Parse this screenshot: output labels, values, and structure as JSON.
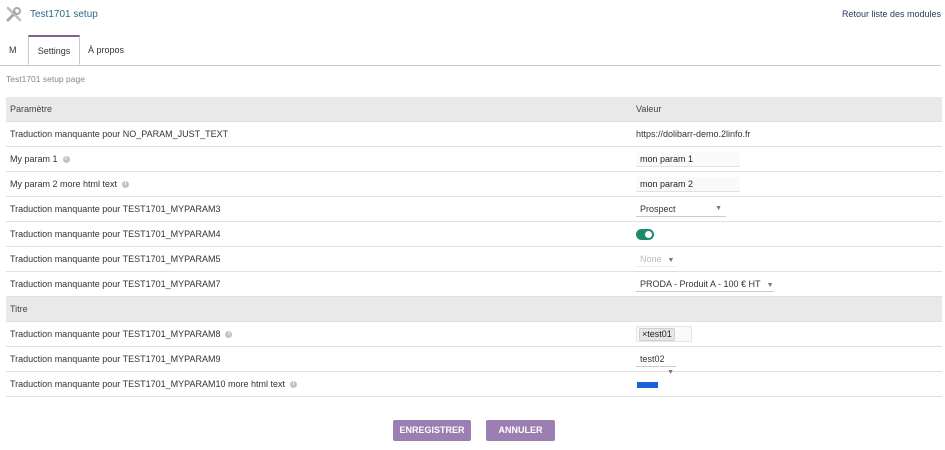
{
  "header": {
    "title": "Test1701 setup",
    "back_link": "Retour liste des modules",
    "icon": "tools-icon"
  },
  "tabs": [
    {
      "label": "M"
    },
    {
      "label": "Settings"
    },
    {
      "label": "À propos"
    }
  ],
  "subtitle": "Test1701 setup page",
  "table": {
    "col_param": "Paramètre",
    "col_value": "Valeur",
    "rows": [
      {
        "label": "Traduction manquante pour NO_PARAM_JUST_TEXT",
        "value": "https://dolibarr-demo.2linfo.fr"
      },
      {
        "label": "My param 1",
        "value": "mon param 1"
      },
      {
        "label": "My param 2 more html text",
        "value": "mon param 2"
      },
      {
        "label": "Traduction manquante pour TEST1701_MYPARAM3",
        "value": "Prospect"
      },
      {
        "label": "Traduction manquante pour TEST1701_MYPARAM4",
        "value": "on"
      },
      {
        "label": "Traduction manquante pour TEST1701_MYPARAM5",
        "value": "None"
      },
      {
        "label": "Traduction manquante pour TEST1701_MYPARAM7",
        "value": "PRODA - Produit A - 100 € HT"
      }
    ],
    "section_title": "Titre",
    "rows2": [
      {
        "label": "Traduction manquante pour TEST1701_MYPARAM8",
        "value": "test01",
        "remove": "×"
      },
      {
        "label": "Traduction manquante pour TEST1701_MYPARAM9",
        "value": "test02"
      },
      {
        "label": "Traduction manquante pour TEST1701_MYPARAM10 more html text",
        "color": "#1a62d8"
      }
    ]
  },
  "buttons": {
    "save": "ENREGISTRER",
    "cancel": "ANNULER"
  },
  "colors": {
    "accent": "#9b7eb2",
    "toggle_on": "#1e8a6b",
    "title": "#2b6a88"
  }
}
